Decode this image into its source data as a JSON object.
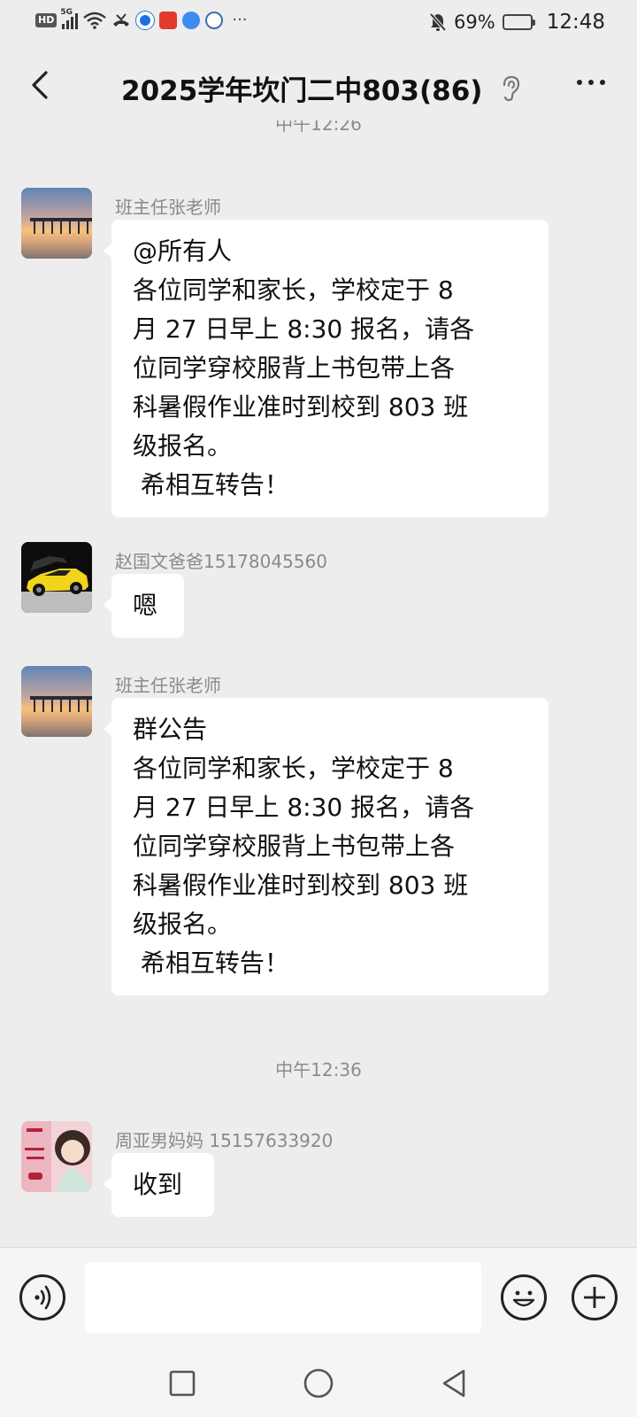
{
  "status_bar": {
    "network": "HD",
    "signal_gen": "5G",
    "battery_percent": "69%",
    "battery_level": 0.69,
    "time": "12:48"
  },
  "header": {
    "back_icon": "chevron-left-icon",
    "title": "2025学年坎门二中803(86)",
    "ear_icon": "ear-icon",
    "more_icon": "more-dots-icon"
  },
  "chat": {
    "top_time": "中午12:26",
    "messages": [
      {
        "sender": "班主任张老师",
        "avatar": "pier-sunset",
        "text": "@所有人\n各位同学和家长，学校定于 8\n月 27 日早上 8:30 报名，请各\n位同学穿校服背上书包带上各\n科暑假作业准时到校到 803 班\n级报名。\n 希相互转告！"
      },
      {
        "sender": "赵国文爸爸15178045560",
        "avatar": "yellow-sports-car",
        "text": "嗯"
      },
      {
        "sender": "班主任张老师",
        "avatar": "pier-sunset",
        "text": "群公告\n各位同学和家长，学校定于 8\n月 27 日早上 8:30 报名，请各\n位同学穿校服背上书包带上各\n科暑假作业准时到校到 803 班\n级报名。\n 希相互转告！"
      }
    ],
    "middle_time": "中午12:36",
    "last_message": {
      "sender": "周亚男妈妈 15157633920",
      "avatar": "girl-illustration",
      "text": "收到"
    }
  },
  "input_bar": {
    "voice_icon": "voice-icon",
    "text_value": "",
    "emoji_icon": "emoji-icon",
    "plus_icon": "plus-icon"
  },
  "nav_bar": {
    "recent_icon": "square-icon",
    "home_icon": "circle-icon",
    "back_icon": "triangle-back-icon"
  },
  "colors": {
    "background": "#ededed",
    "bubble": "#ffffff",
    "meta_text": "#8a8a8a"
  }
}
